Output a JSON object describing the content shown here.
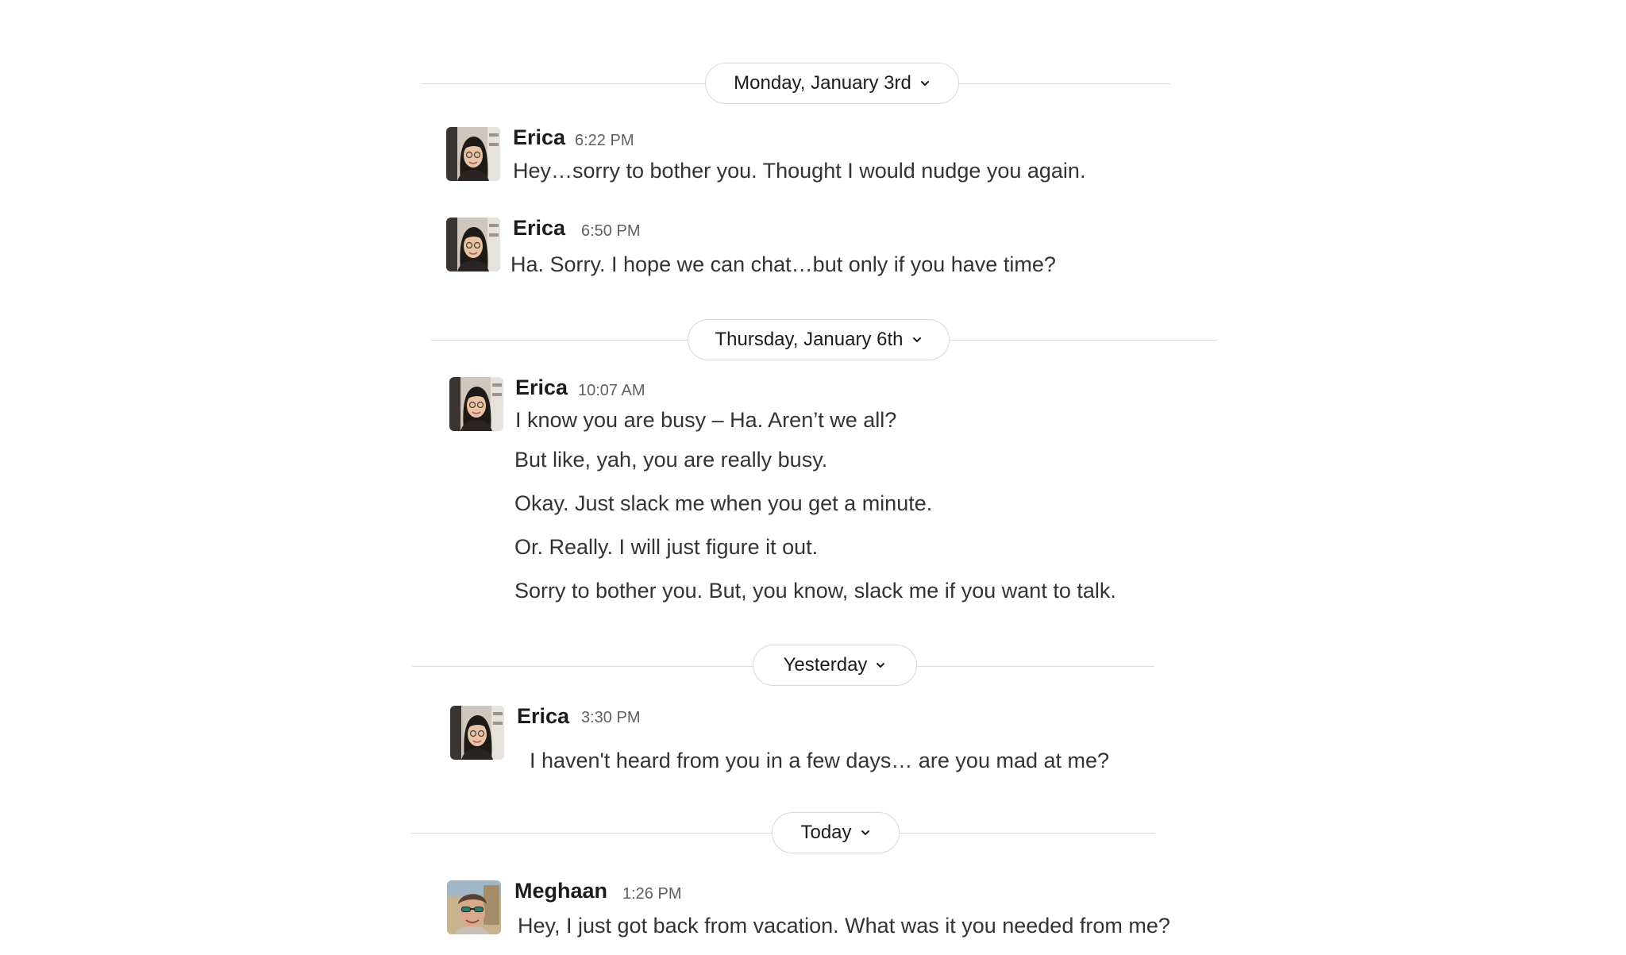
{
  "dates": {
    "d1": "Monday, January 3rd",
    "d2": "Thursday, January 6th",
    "d3": "Yesterday",
    "d4": "Today"
  },
  "messages": [
    {
      "sender": "Erica",
      "time": "6:22 PM",
      "lines": [
        "Hey…sorry to bother you. Thought I would nudge you again."
      ]
    },
    {
      "sender": "Erica",
      "time": "6:50 PM",
      "lines": [
        "Ha. Sorry. I hope we can chat…but only if you have time?"
      ]
    },
    {
      "sender": "Erica",
      "time": "10:07 AM",
      "lines": [
        "I know you are busy – Ha. Aren’t we all?",
        "But like, yah, you are really busy.",
        "Okay. Just slack me when you get a minute.",
        "Or. Really. I will just figure it out.",
        "Sorry to bother you. But, you know, slack me if you want to talk."
      ]
    },
    {
      "sender": "Erica",
      "time": "3:30 PM",
      "lines": [
        "I haven't heard from you in a few days… are you mad at me?"
      ]
    },
    {
      "sender": "Meghaan",
      "time": "1:26 PM",
      "lines": [
        "Hey, I just got back from vacation. What was it you needed from me?"
      ]
    }
  ]
}
